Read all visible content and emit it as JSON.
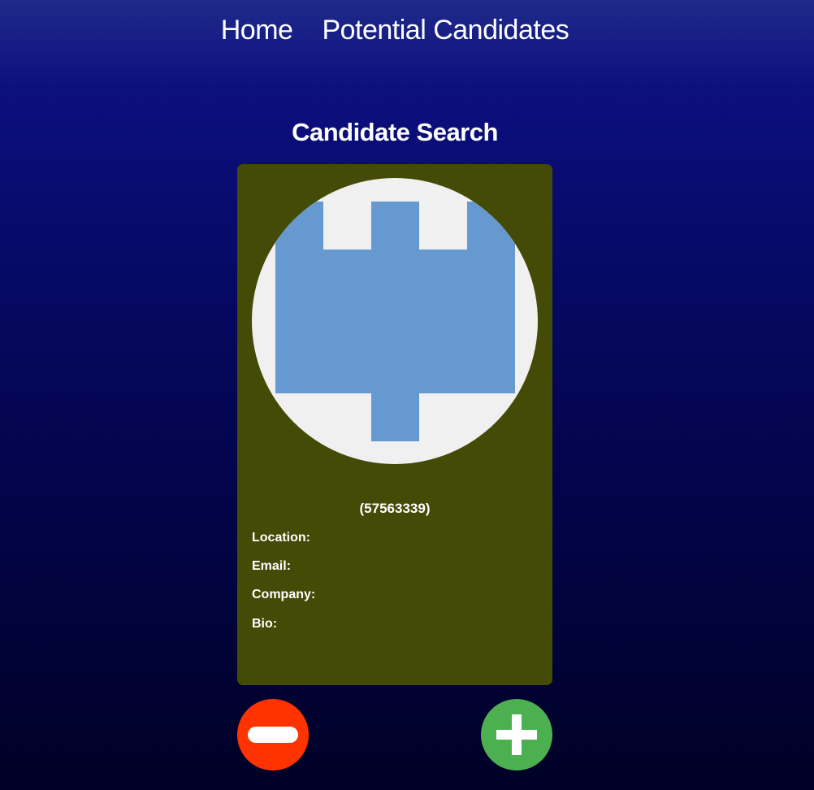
{
  "nav": {
    "home_label": "Home",
    "candidates_label": "Potential Candidates"
  },
  "page": {
    "title": "Candidate Search"
  },
  "candidate": {
    "login": "(57563339)",
    "location_label": "Location:",
    "email_label": "Email:",
    "company_label": "Company:",
    "bio_label": "Bio:",
    "avatar_icon": "identicon-avatar"
  },
  "actions": {
    "reject_icon": "minus-icon",
    "accept_icon": "plus-icon"
  },
  "colors": {
    "card_background": "#444b06",
    "identicon_color": "#6699cf",
    "identicon_background": "#f0f0f0",
    "reject_button": "#ff3300",
    "accept_button": "#4caf50"
  }
}
